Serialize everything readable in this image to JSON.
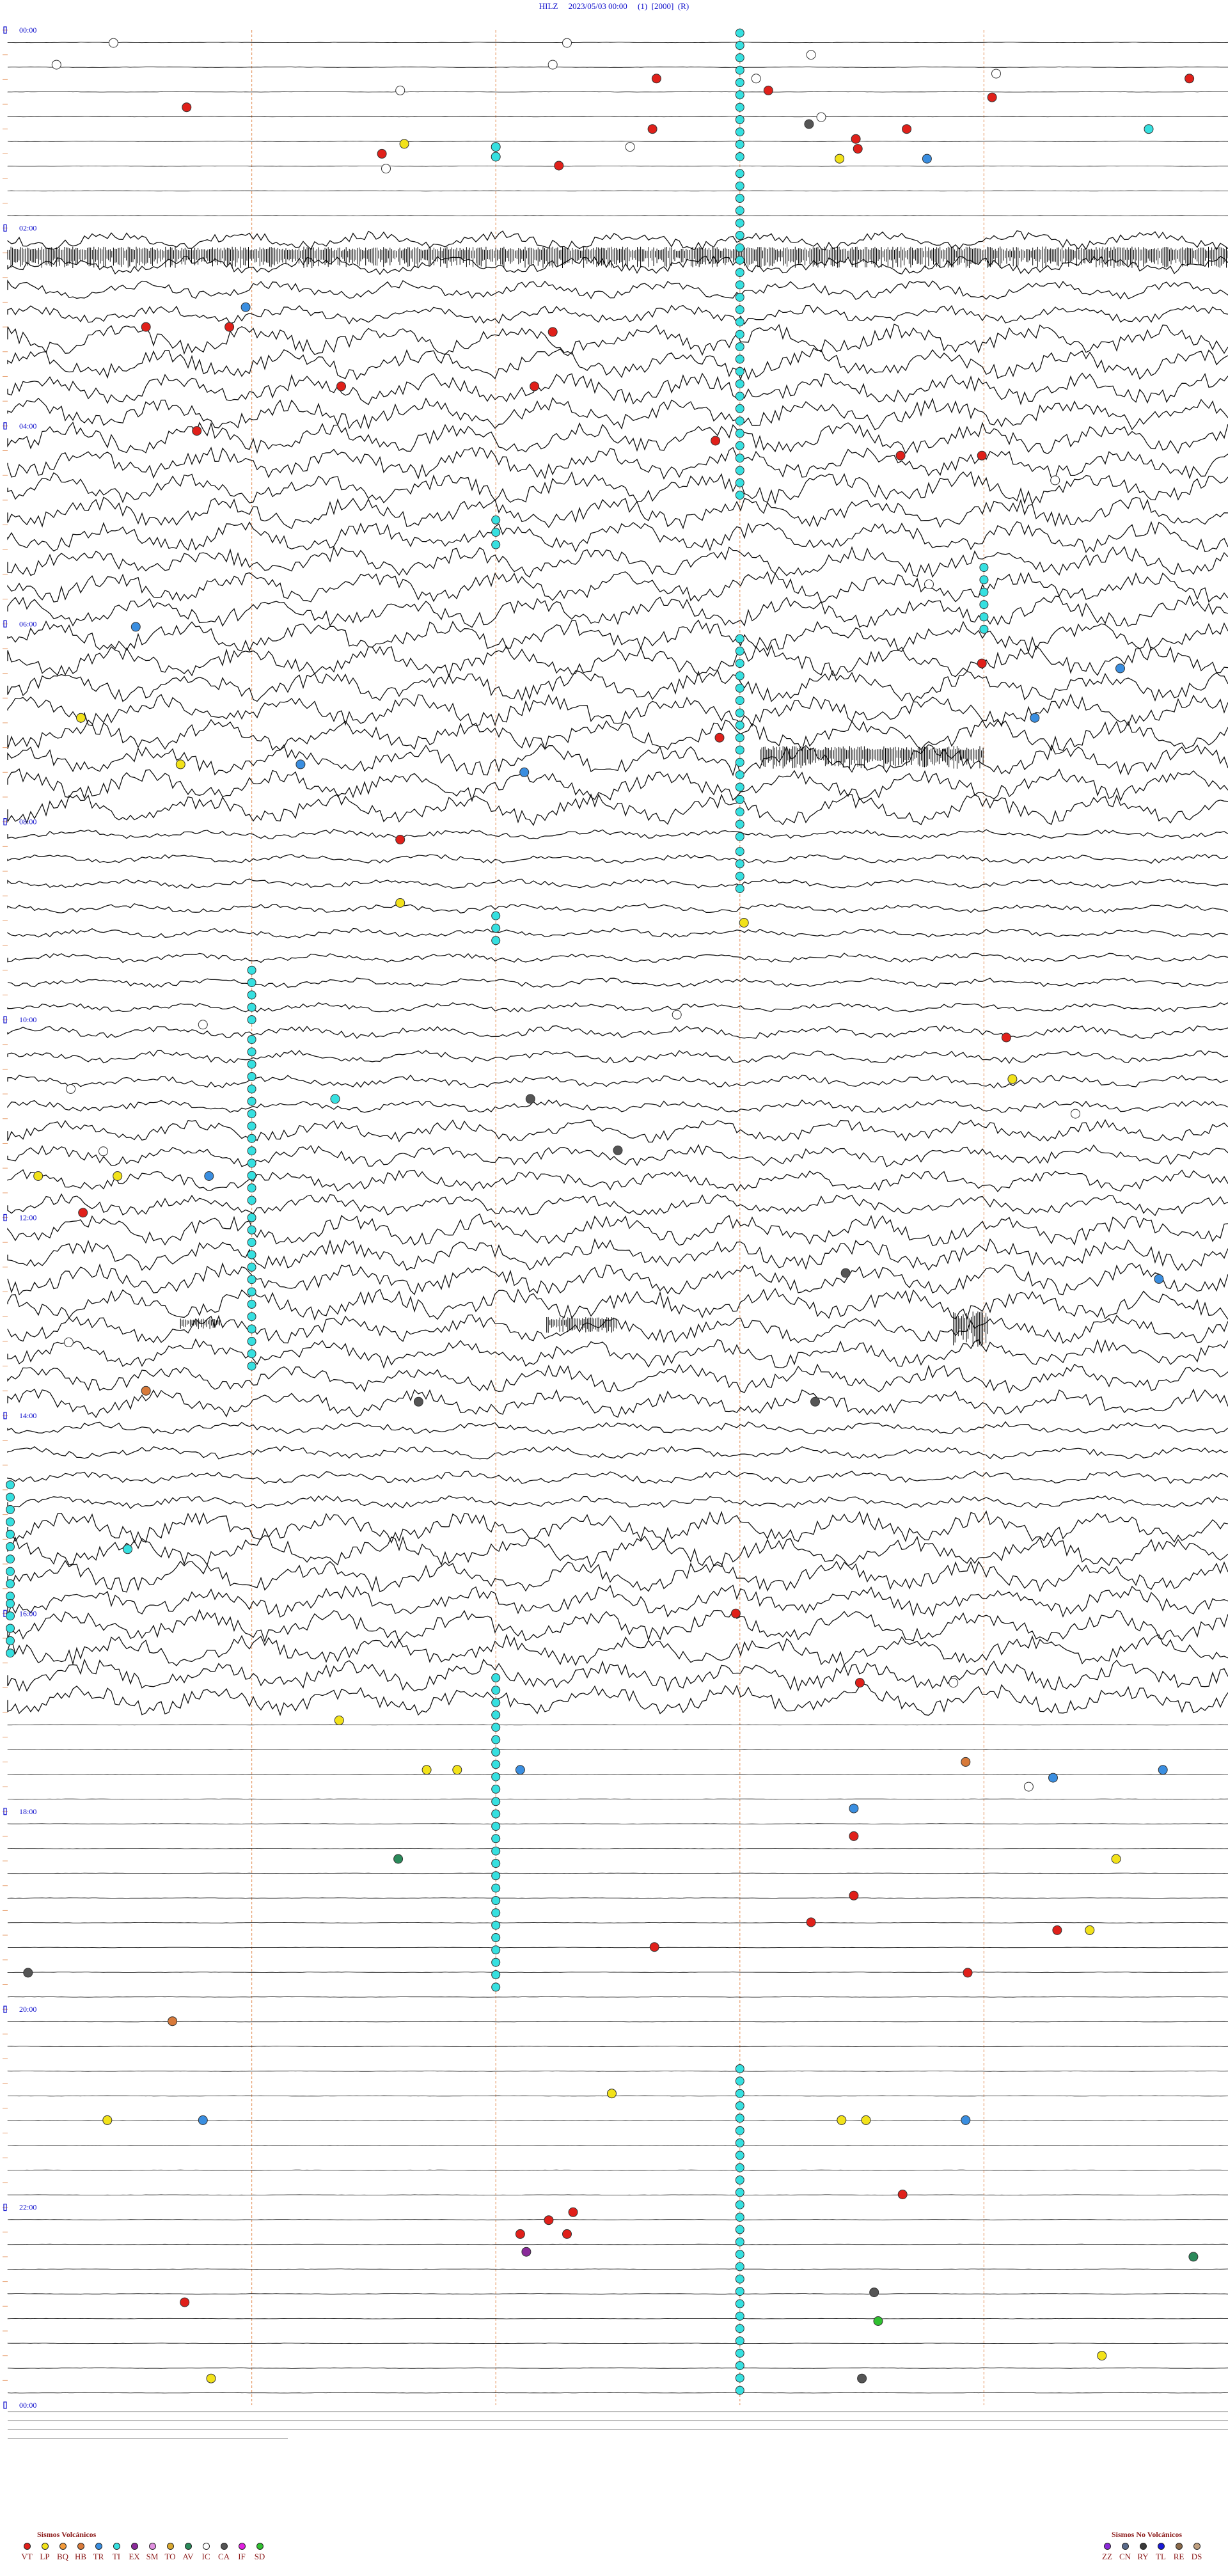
{
  "header": {
    "station": "HILZ",
    "datetime": "2023/05/03 00:00",
    "p1": "(1)",
    "p2": "[2000]",
    "p3": "(R)"
  },
  "chart_data": {
    "type": "scatter",
    "title": "HILZ    2023/05/03 00:00     (1)     [2000]     (R)",
    "x_unit": "minutes within the hour",
    "xlim": [
      0,
      60
    ],
    "y_unit": "hour of day",
    "ylim": [
      0,
      24
    ],
    "hour_labels": [
      {
        "hour": 0,
        "label": "00:00"
      },
      {
        "hour": 2,
        "label": "02:00"
      },
      {
        "hour": 4,
        "label": "04:00"
      },
      {
        "hour": 6,
        "label": "06:00"
      },
      {
        "hour": 8,
        "label": "08:00"
      },
      {
        "hour": 10,
        "label": "10:00"
      },
      {
        "hour": 12,
        "label": "12:00"
      },
      {
        "hour": 14,
        "label": "14:00"
      },
      {
        "hour": 16,
        "label": "16:00"
      },
      {
        "hour": 18,
        "label": "18:00"
      },
      {
        "hour": 20,
        "label": "20:00"
      },
      {
        "hour": 22,
        "label": "22:00"
      },
      {
        "hour": 24,
        "label": "00:00"
      }
    ],
    "minute_gridlines": [
      12,
      24,
      36,
      48
    ],
    "trace_noise_by_hour": [
      0.1,
      0.1,
      0.6,
      1,
      1,
      1,
      1,
      1,
      0.3,
      0.3,
      0.4,
      0.7,
      1,
      0.9,
      0.4,
      1,
      1,
      0.1,
      0.1,
      0.1,
      0.1,
      0.1,
      0.1,
      0.1
    ],
    "event_types": {
      "VT": "#e0201a",
      "LP": "#f2e21a",
      "BQ": "#f29a3a",
      "HB": "#d87a3a",
      "TR": "#3a8ee0",
      "TI": "#36e0e0",
      "EX": "#8a2a9a",
      "SM": "#e090e0",
      "TO": "#d8a830",
      "AV": "#2a8a5a",
      "IC": "#ffffff",
      "CA": "#555555",
      "IF": "#e020e0",
      "SD": "#30c030"
    },
    "events": [
      {
        "type": "IC",
        "t": 5.2,
        "h": 0.13
      },
      {
        "type": "IC",
        "t": 2.4,
        "h": 0.35
      },
      {
        "type": "IC",
        "t": 27.5,
        "h": 0.13
      },
      {
        "type": "IC",
        "t": 39.5,
        "h": 0.25
      },
      {
        "type": "IC",
        "t": 26.8,
        "h": 0.35
      },
      {
        "type": "VT",
        "t": 31.9,
        "h": 0.49
      },
      {
        "type": "IC",
        "t": 36.8,
        "h": 0.49
      },
      {
        "type": "VT",
        "t": 37.4,
        "h": 0.61
      },
      {
        "type": "IC",
        "t": 48.6,
        "h": 0.44
      },
      {
        "type": "VT",
        "t": 58.1,
        "h": 0.49
      },
      {
        "type": "IC",
        "t": 19.3,
        "h": 0.61
      },
      {
        "type": "VT",
        "t": 48.4,
        "h": 0.68
      },
      {
        "type": "VT",
        "t": 8.8,
        "h": 0.78
      },
      {
        "type": "IC",
        "t": 40.0,
        "h": 0.88
      },
      {
        "type": "CA",
        "t": 39.4,
        "h": 0.95
      },
      {
        "type": "VT",
        "t": 31.7,
        "h": 1.0
      },
      {
        "type": "VT",
        "t": 44.2,
        "h": 1.0
      },
      {
        "type": "TI",
        "t": 56.1,
        "h": 1.0
      },
      {
        "type": "LP",
        "t": 19.5,
        "h": 1.15
      },
      {
        "type": "VT",
        "t": 41.7,
        "h": 1.1
      },
      {
        "type": "VT",
        "t": 18.4,
        "h": 1.25
      },
      {
        "type": "VT",
        "t": 41.8,
        "h": 1.2
      },
      {
        "type": "IC",
        "t": 30.6,
        "h": 1.18
      },
      {
        "type": "LP",
        "t": 40.9,
        "h": 1.3
      },
      {
        "type": "TR",
        "t": 45.2,
        "h": 1.3
      },
      {
        "type": "VT",
        "t": 27.1,
        "h": 1.37
      },
      {
        "type": "IC",
        "t": 18.6,
        "h": 1.4
      },
      {
        "type": "TI",
        "t": 24.0,
        "h": 1.18
      },
      {
        "type": "TI",
        "t": 24.0,
        "h": 1.28
      },
      {
        "type": "VT",
        "t": 6.8,
        "h": 3.0
      },
      {
        "type": "VT",
        "t": 10.9,
        "h": 3.0
      },
      {
        "type": "VT",
        "t": 26.8,
        "h": 3.05
      },
      {
        "type": "TR",
        "t": 11.7,
        "h": 2.8
      },
      {
        "type": "VT",
        "t": 16.4,
        "h": 3.6
      },
      {
        "type": "VT",
        "t": 25.9,
        "h": 3.6
      },
      {
        "type": "VT",
        "t": 9.3,
        "h": 4.05
      },
      {
        "type": "VT",
        "t": 34.8,
        "h": 4.15
      },
      {
        "type": "VT",
        "t": 43.9,
        "h": 4.3
      },
      {
        "type": "VT",
        "t": 47.9,
        "h": 4.3
      },
      {
        "type": "IC",
        "t": 51.5,
        "h": 4.55
      },
      {
        "type": "IC",
        "t": 45.3,
        "h": 5.6
      },
      {
        "type": "VT",
        "t": 47.9,
        "h": 6.4
      },
      {
        "type": "TR",
        "t": 54.7,
        "h": 6.45
      },
      {
        "type": "TR",
        "t": 6.3,
        "h": 6.03
      },
      {
        "type": "LP",
        "t": 3.6,
        "h": 6.95
      },
      {
        "type": "TR",
        "t": 50.5,
        "h": 6.95
      },
      {
        "type": "VT",
        "t": 35.0,
        "h": 7.15
      },
      {
        "type": "LP",
        "t": 8.5,
        "h": 7.42
      },
      {
        "type": "TR",
        "t": 14.4,
        "h": 7.42
      },
      {
        "type": "TR",
        "t": 25.4,
        "h": 7.5
      },
      {
        "type": "VT",
        "t": 19.3,
        "h": 8.18
      },
      {
        "type": "LP",
        "t": 19.3,
        "h": 8.82
      },
      {
        "type": "LP",
        "t": 36.2,
        "h": 9.02
      },
      {
        "type": "IC",
        "t": 32.9,
        "h": 9.95
      },
      {
        "type": "IC",
        "t": 9.6,
        "h": 10.05
      },
      {
        "type": "VT",
        "t": 49.1,
        "h": 10.18
      },
      {
        "type": "LP",
        "t": 49.4,
        "h": 10.6
      },
      {
        "type": "IC",
        "t": 3.1,
        "h": 10.7
      },
      {
        "type": "CA",
        "t": 25.7,
        "h": 10.8
      },
      {
        "type": "TI",
        "t": 16.1,
        "h": 10.8
      },
      {
        "type": "IC",
        "t": 52.5,
        "h": 10.95
      },
      {
        "type": "CA",
        "t": 30.0,
        "h": 11.32
      },
      {
        "type": "LP",
        "t": 1.5,
        "h": 11.58
      },
      {
        "type": "IC",
        "t": 4.7,
        "h": 11.33
      },
      {
        "type": "LP",
        "t": 5.4,
        "h": 11.58
      },
      {
        "type": "TR",
        "t": 9.9,
        "h": 11.58
      },
      {
        "type": "VT",
        "t": 3.7,
        "h": 11.95
      },
      {
        "type": "CA",
        "t": 41.2,
        "h": 12.56
      },
      {
        "type": "TR",
        "t": 56.6,
        "h": 12.62
      },
      {
        "type": "IC",
        "t": 3.0,
        "h": 13.26
      },
      {
        "type": "HB",
        "t": 6.8,
        "h": 13.75
      },
      {
        "type": "CA",
        "t": 20.2,
        "h": 13.86
      },
      {
        "type": "CA",
        "t": 39.7,
        "h": 13.86
      },
      {
        "type": "TI",
        "t": 5.9,
        "h": 15.35
      },
      {
        "type": "VT",
        "t": 35.8,
        "h": 16.0
      },
      {
        "type": "VT",
        "t": 41.9,
        "h": 16.7
      },
      {
        "type": "IC",
        "t": 46.5,
        "h": 16.7
      },
      {
        "type": "LP",
        "t": 16.3,
        "h": 17.08
      },
      {
        "type": "TR",
        "t": 25.2,
        "h": 17.58
      },
      {
        "type": "LP",
        "t": 20.6,
        "h": 17.58
      },
      {
        "type": "LP",
        "t": 22.1,
        "h": 17.58
      },
      {
        "type": "HB",
        "t": 47.1,
        "h": 17.5
      },
      {
        "type": "TR",
        "t": 51.4,
        "h": 17.66
      },
      {
        "type": "IC",
        "t": 50.2,
        "h": 17.75
      },
      {
        "type": "TR",
        "t": 56.8,
        "h": 17.58
      },
      {
        "type": "VT",
        "t": 41.6,
        "h": 18.25
      },
      {
        "type": "TR",
        "t": 41.6,
        "h": 17.97
      },
      {
        "type": "AV",
        "t": 19.2,
        "h": 18.48
      },
      {
        "type": "LP",
        "t": 54.5,
        "h": 18.48
      },
      {
        "type": "VT",
        "t": 41.6,
        "h": 18.85
      },
      {
        "type": "VT",
        "t": 39.5,
        "h": 19.12
      },
      {
        "type": "LP",
        "t": 53.2,
        "h": 19.2
      },
      {
        "type": "VT",
        "t": 51.6,
        "h": 19.2
      },
      {
        "type": "VT",
        "t": 31.8,
        "h": 19.37
      },
      {
        "type": "VT",
        "t": 47.2,
        "h": 19.63
      },
      {
        "type": "CA",
        "t": 1.0,
        "h": 19.63
      },
      {
        "type": "HB",
        "t": 8.1,
        "h": 20.12
      },
      {
        "type": "LP",
        "t": 29.7,
        "h": 20.85
      },
      {
        "type": "LP",
        "t": 4.9,
        "h": 21.12
      },
      {
        "type": "TR",
        "t": 9.6,
        "h": 21.12
      },
      {
        "type": "LP",
        "t": 41.0,
        "h": 21.12
      },
      {
        "type": "LP",
        "t": 42.2,
        "h": 21.12
      },
      {
        "type": "TR",
        "t": 47.1,
        "h": 21.12
      },
      {
        "type": "VT",
        "t": 44.0,
        "h": 21.87
      },
      {
        "type": "VT",
        "t": 27.8,
        "h": 22.05
      },
      {
        "type": "VT",
        "t": 26.6,
        "h": 22.13
      },
      {
        "type": "VT",
        "t": 25.2,
        "h": 22.27
      },
      {
        "type": "VT",
        "t": 27.5,
        "h": 22.27
      },
      {
        "type": "EX",
        "t": 25.5,
        "h": 22.45
      },
      {
        "type": "AV",
        "t": 58.3,
        "h": 22.5
      },
      {
        "type": "VT",
        "t": 8.7,
        "h": 22.96
      },
      {
        "type": "CA",
        "t": 42.6,
        "h": 22.86
      },
      {
        "type": "SD",
        "t": 42.8,
        "h": 23.15
      },
      {
        "type": "LP",
        "t": 53.8,
        "h": 23.5
      },
      {
        "type": "LP",
        "t": 10.0,
        "h": 23.73
      },
      {
        "type": "CA",
        "t": 42.0,
        "h": 23.73
      }
    ],
    "event_runs": [
      {
        "type": "TI",
        "t": 36.0,
        "h_from": 0.03,
        "h_to": 1.38
      },
      {
        "type": "TI",
        "t": 36.0,
        "h_from": 1.45,
        "h_to": 4.7
      },
      {
        "type": "TI",
        "t": 24.0,
        "h_from": 4.95,
        "h_to": 5.2
      },
      {
        "type": "TI",
        "t": 48.0,
        "h_from": 5.43,
        "h_to": 6.1
      },
      {
        "type": "TI",
        "t": 36.0,
        "h_from": 6.15,
        "h_to": 8.25
      },
      {
        "type": "TI",
        "t": 36.0,
        "h_from": 8.3,
        "h_to": 8.8
      },
      {
        "type": "TI",
        "t": 24.0,
        "h_from": 8.95,
        "h_to": 9.28
      },
      {
        "type": "TI",
        "t": 12.0,
        "h_from": 9.5,
        "h_to": 10.08
      },
      {
        "type": "TI",
        "t": 12.0,
        "h_from": 10.2,
        "h_to": 11.9
      },
      {
        "type": "TI",
        "t": 12.0,
        "h_from": 12.0,
        "h_to": 13.58
      },
      {
        "type": "TI",
        "t": 0.0,
        "h_from": 14.7,
        "h_to": 15.85
      },
      {
        "type": "TI",
        "t": 0.0,
        "h_from": 15.9,
        "h_to": 16.5
      },
      {
        "type": "TI",
        "t": 24.0,
        "h_from": 16.65,
        "h_to": 19.85
      },
      {
        "type": "TI",
        "t": 36.0,
        "h_from": 20.6,
        "h_to": 23.95
      }
    ],
    "spikes": [
      {
        "h": 2.25,
        "t_from": 0,
        "t_to": 60,
        "amp": 24
      },
      {
        "h": 7.3,
        "t_from": 37,
        "t_to": 48,
        "amp": 26
      },
      {
        "h": 13.05,
        "t_from": 26.5,
        "t_to": 30.0,
        "amp": 18
      },
      {
        "h": 13.05,
        "t_from": 8.5,
        "t_to": 10.5,
        "amp": 12
      },
      {
        "h": 13.05,
        "t_from": 46.5,
        "t_to": 48.2,
        "amp": 40
      }
    ]
  },
  "legend": {
    "volcanic_title": "Sismos Volcánicos",
    "volcanic": [
      "VT",
      "LP",
      "BQ",
      "HB",
      "TR",
      "TI",
      "EX",
      "SM",
      "TO",
      "AV",
      "IC",
      "CA",
      "IF",
      "SD"
    ],
    "non_volcanic_title": "Sismos No Volcánicos",
    "non_volcanic": [
      {
        "label": "ZZ",
        "color": "#8a2ad8"
      },
      {
        "label": "CN",
        "color": "#5a6a8a"
      },
      {
        "label": "RY",
        "color": "#3a3a3a"
      },
      {
        "label": "TL",
        "color": "#1a1ad8"
      },
      {
        "label": "RE",
        "color": "#8a6a4a"
      },
      {
        "label": "DS",
        "color": "#c0a080"
      }
    ]
  }
}
